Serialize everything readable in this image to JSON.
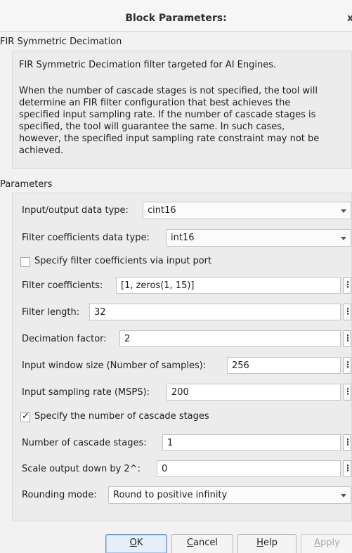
{
  "window": {
    "title": "Block Parameters:",
    "close_glyph": "x"
  },
  "block": {
    "name": "FIR Symmetric Decimation",
    "description_lines": [
      "FIR Symmetric Decimation filter targeted for AI Engines.",
      "When the number of cascade stages is not specified, the tool will",
      "determine an FIR filter configuration that best achieves the",
      "specified input sampling rate. If the number of cascade stages is",
      "specified, the tool will guarantee the same. In such cases,",
      "however, the specified input sampling rate constraint may not be",
      "achieved."
    ]
  },
  "parameters": {
    "section_title": "Parameters",
    "io_data_type": {
      "label": "Input/output data type:",
      "value": "cint16"
    },
    "coeff_data_type": {
      "label": "Filter coefficients data type:",
      "value": "int16"
    },
    "coeff_via_port": {
      "label": "Specify filter coefficients via input port",
      "checked": false
    },
    "filter_coefficients": {
      "label": "Filter coefficients:",
      "value": "[1, zeros(1, 15)]"
    },
    "filter_length": {
      "label": "Filter length:",
      "value": "32"
    },
    "decimation_factor": {
      "label": "Decimation factor:",
      "value": "2"
    },
    "input_window_size": {
      "label": "Input window size (Number of samples):",
      "value": "256"
    },
    "input_sampling_rate": {
      "label": "Input sampling rate (MSPS):",
      "value": "200"
    },
    "specify_cascade": {
      "label": "Specify the number of cascade stages",
      "checked": true,
      "mark": "✓"
    },
    "num_cascade_stages": {
      "label": "Number of cascade stages:",
      "value": "1"
    },
    "scale_output": {
      "label": "Scale output down by 2^:",
      "value": "0"
    },
    "rounding_mode": {
      "label": "Rounding mode:",
      "value": "Round to positive infinity"
    },
    "more_glyph": "⋮"
  },
  "buttons": {
    "ok": {
      "mnemonic": "O",
      "rest": "K"
    },
    "cancel": {
      "mnemonic": "C",
      "rest": "ancel"
    },
    "help": {
      "mnemonic": "H",
      "rest": "elp"
    },
    "apply": {
      "mnemonic": "A",
      "rest": "pply",
      "enabled": false
    }
  },
  "icons": {
    "dropdown": "chevron-down-icon",
    "more": "more-options-icon",
    "check": "check-mark-icon",
    "close": "close-icon"
  },
  "colors": {
    "window_bg": "#f2f2f2",
    "panel_bg": "#ececec",
    "default_button_border": "#6c95c8"
  }
}
